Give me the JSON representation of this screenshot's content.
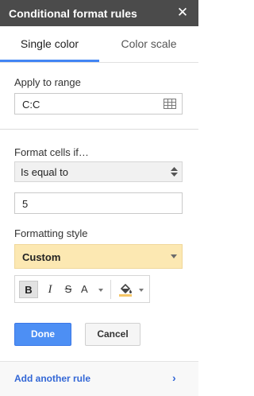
{
  "header": {
    "title": "Conditional format rules",
    "close_glyph": "✕"
  },
  "tabs": [
    {
      "label": "Single color",
      "active": true
    },
    {
      "label": "Color scale",
      "active": false
    }
  ],
  "range": {
    "label": "Apply to range",
    "value": "C:C",
    "icon": "grid-icon"
  },
  "format": {
    "label": "Format cells if…",
    "condition": "Is equal to",
    "value": "5"
  },
  "style": {
    "label": "Formatting style",
    "selected": "Custom",
    "highlight_color": "#fce8b2",
    "toolbar": {
      "bold": "B",
      "italic": "I",
      "strike": "S",
      "text_color": "A",
      "fill_icon": "paint-bucket-icon"
    }
  },
  "actions": {
    "done": "Done",
    "cancel": "Cancel",
    "accent": "#4d8ff4"
  },
  "footer": {
    "add_rule": "Add another rule",
    "chevron": "›"
  }
}
